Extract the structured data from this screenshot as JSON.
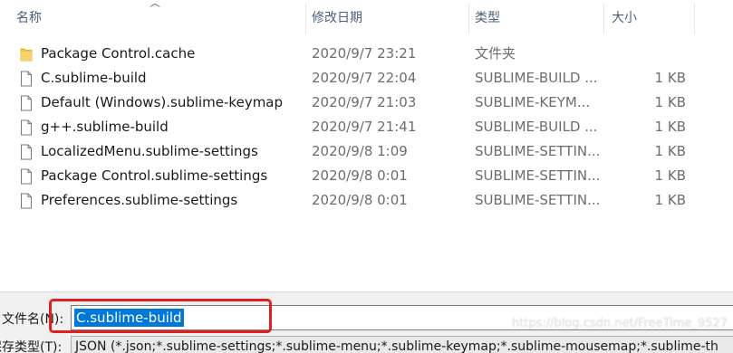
{
  "columns": {
    "name": "名称",
    "date": "修改日期",
    "type": "类型",
    "size": "大小"
  },
  "files": [
    {
      "name": "Package Control.cache",
      "date": "2020/9/7 23:21",
      "type": "文件夹",
      "size": "",
      "icon": "folder-icon"
    },
    {
      "name": "C.sublime-build",
      "date": "2020/9/7 22:04",
      "type": "SUBLIME-BUILD ...",
      "size": "1 KB",
      "icon": "file-icon"
    },
    {
      "name": "Default (Windows).sublime-keymap",
      "date": "2020/9/7 21:03",
      "type": "SUBLIME-KEYM...",
      "size": "1 KB",
      "icon": "file-icon"
    },
    {
      "name": "g++.sublime-build",
      "date": "2020/9/7 21:41",
      "type": "SUBLIME-BUILD ...",
      "size": "1 KB",
      "icon": "file-icon"
    },
    {
      "name": "LocalizedMenu.sublime-settings",
      "date": "2020/9/8 1:09",
      "type": "SUBLIME-SETTIN...",
      "size": "1 KB",
      "icon": "file-icon"
    },
    {
      "name": "Package Control.sublime-settings",
      "date": "2020/9/8 0:01",
      "type": "SUBLIME-SETTIN...",
      "size": "1 KB",
      "icon": "file-icon"
    },
    {
      "name": "Preferences.sublime-settings",
      "date": "2020/9/8 0:01",
      "type": "SUBLIME-SETTIN...",
      "size": "1 KB",
      "icon": "file-icon"
    }
  ],
  "filename": {
    "label": "文件名(N):",
    "value": "C.sublime-build"
  },
  "save_type": {
    "label": "保存类型(T):",
    "value": "JSON (*.json;*.sublime-settings;*.sublime-menu;*.sublime-keymap;*.sublime-mousemap;*.sublime-th"
  },
  "watermark": "https://blog.csdn.net/FreeTime_9527",
  "colors": {
    "selection": "#0078d7",
    "highlight_box": "#e02020",
    "folder": "#f2c24b"
  }
}
